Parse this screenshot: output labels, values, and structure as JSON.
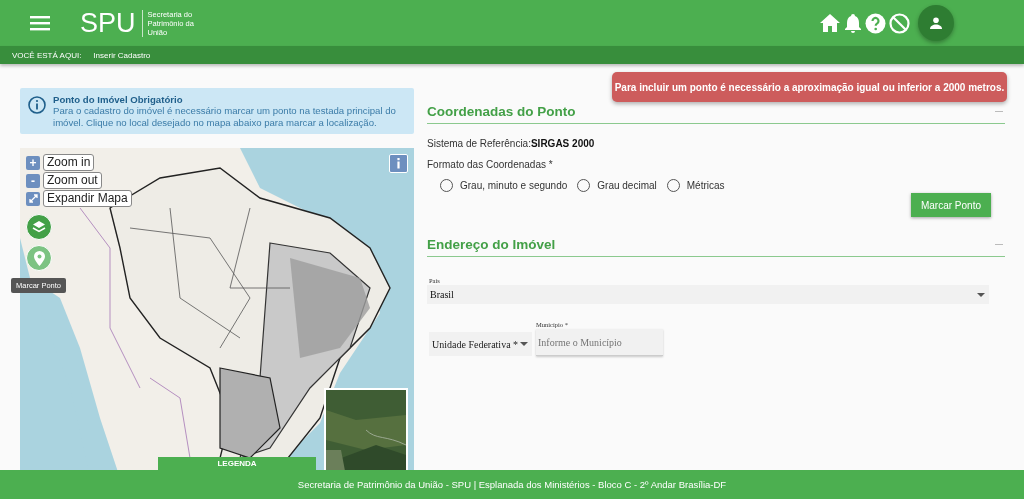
{
  "header": {
    "logo": "SPU",
    "subtitle_lines": [
      "Secretaria do",
      "Patrimônio da",
      "União"
    ]
  },
  "breadcrumb": {
    "label": "VOCÊ ESTÁ AQUI:",
    "current": "Inserir Cadastro"
  },
  "toast": {
    "message": "Para incluir um ponto é necessário a aproximação igual ou inferior a 2000 metros."
  },
  "info_alert": {
    "title": "Ponto do Imóvel Obrigatório",
    "text": "Para o cadastro do imóvel é necessário marcar um ponto na testada principal do imóvel. Clique no local desejado no mapa abaixo para marcar a localização."
  },
  "map": {
    "controls": [
      {
        "kind": "zoom",
        "symbol": "+",
        "label": "Zoom in"
      },
      {
        "kind": "zoom",
        "symbol": "-",
        "label": "Zoom out"
      },
      {
        "kind": "expand",
        "label": "Expandir Mapa"
      }
    ],
    "tooltip": "Marcar Ponto",
    "legend": "LEGENDA"
  },
  "coordinates": {
    "title": "Coordenadas do Ponto",
    "reference_label": "Sistema de Referência:",
    "reference_value": "SIRGAS 2000",
    "format_label": "Formato das Coordenadas *",
    "options": [
      {
        "label": "Grau, minuto e segundo",
        "selected": false
      },
      {
        "label": "Grau decimal",
        "selected": false
      },
      {
        "label": "Métricas",
        "selected": false
      }
    ],
    "button": "Marcar Ponto"
  },
  "address": {
    "title": "Endereço do Imóvel",
    "country": {
      "label": "País",
      "value": "Brasil"
    },
    "state": {
      "placeholder": "Unidade Federativa *"
    },
    "municipality": {
      "label": "Município *",
      "placeholder": "Informe o Município"
    }
  },
  "footer": "Secretaria de Patrimônio da União - SPU | Esplanada dos Ministérios - Bloco C - 2º Andar Brasília-DF"
}
